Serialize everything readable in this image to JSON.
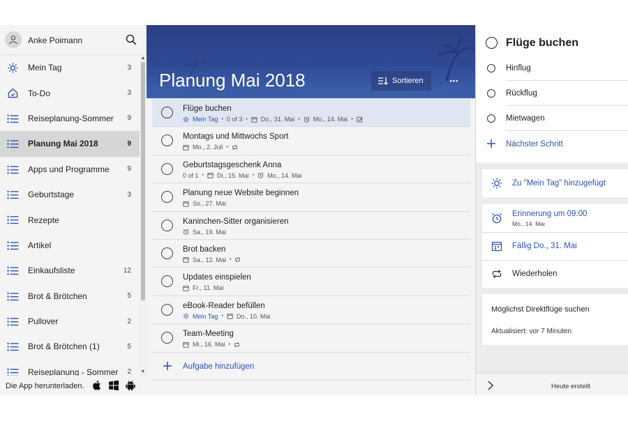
{
  "user": {
    "name": "Anke Poimann"
  },
  "sidebar": {
    "items": [
      {
        "label": "Mein Tag",
        "count": "3",
        "icon": "sun-icon"
      },
      {
        "label": "To-Do",
        "count": "3",
        "icon": "home-icon"
      },
      {
        "label": "Reiseplanung-Sommer",
        "count": "9",
        "icon": "list-icon"
      },
      {
        "label": "Planung Mai 2018",
        "count": "9",
        "icon": "list-icon",
        "active": true
      },
      {
        "label": "Apps und Programme",
        "count": "9",
        "icon": "list-icon"
      },
      {
        "label": "Geburtstage",
        "count": "3",
        "icon": "list-icon"
      },
      {
        "label": "Rezepte",
        "count": "",
        "icon": "list-icon"
      },
      {
        "label": "Artikel",
        "count": "",
        "icon": "list-icon"
      },
      {
        "label": "Einkaufsliste",
        "count": "12",
        "icon": "list-icon"
      },
      {
        "label": "Brot & Brötchen",
        "count": "5",
        "icon": "list-icon"
      },
      {
        "label": "Pullover",
        "count": "2",
        "icon": "list-icon"
      },
      {
        "label": "Brot & Brötchen (1)",
        "count": "5",
        "icon": "list-icon"
      },
      {
        "label": "Reiseplanung - Sommer",
        "count": "2",
        "icon": "list-icon"
      }
    ],
    "download_label": "Die App herunterladen."
  },
  "main": {
    "title": "Planung Mai 2018",
    "sort_label": "Sortieren",
    "more_label": "•••",
    "add_task_label": "Aufgabe hinzufügen",
    "tasks": [
      {
        "title": "Flüge buchen",
        "selected": true,
        "meta": [
          {
            "icon": "sun-icon",
            "text": "Mein Tag",
            "blue": true
          },
          {
            "text": "0 of 3"
          },
          {
            "icon": "calendar-icon",
            "text": "Do., 31. Mai"
          },
          {
            "icon": "alarm-icon",
            "text": "Mo., 14. Mai"
          },
          {
            "icon": "note-icon",
            "text": ""
          }
        ]
      },
      {
        "title": "Montags und Mittwochs Sport",
        "meta": [
          {
            "icon": "calendar-icon",
            "text": "Mo., 2. Juli"
          },
          {
            "icon": "repeat-icon",
            "text": ""
          }
        ]
      },
      {
        "title": "Geburtstagsgeschenk Anna",
        "meta": [
          {
            "text": "0 of 1"
          },
          {
            "icon": "calendar-icon",
            "text": "Di., 15. Mai"
          },
          {
            "icon": "alarm-icon",
            "text": "Mo., 14. Mai"
          }
        ]
      },
      {
        "title": "Planung neue Website beginnen",
        "meta": [
          {
            "icon": "calendar-icon",
            "text": "So., 27. Mai"
          }
        ]
      },
      {
        "title": "Kaninchen-Sitter organisieren",
        "meta": [
          {
            "icon": "alarm-icon",
            "text": "Sa., 19. Mai"
          }
        ]
      },
      {
        "title": "Brot backen",
        "meta": [
          {
            "icon": "calendar-icon",
            "text": "Sa., 12. Mai"
          },
          {
            "icon": "repeat-icon",
            "text": ""
          }
        ]
      },
      {
        "title": "Updates einspielen",
        "meta": [
          {
            "icon": "calendar-icon",
            "text": "Fr., 11. Mai"
          }
        ]
      },
      {
        "title": "eBook-Reader befüllen",
        "meta": [
          {
            "icon": "sun-icon",
            "text": "Mein Tag",
            "blue": true
          },
          {
            "icon": "calendar-icon",
            "text": "Do., 10. Mai"
          }
        ]
      },
      {
        "title": "Team-Meeting",
        "meta": [
          {
            "icon": "calendar-icon",
            "text": "Mi., 16. Mai"
          },
          {
            "icon": "repeat-icon",
            "text": ""
          }
        ]
      }
    ]
  },
  "detail": {
    "title": "Flüge buchen",
    "steps": [
      "Hinflug",
      "Rückflug",
      "Mietwagen"
    ],
    "next_step_label": "Nächster Schritt",
    "my_day_label": "Zu \"Mein Tag\" hinzugefügt",
    "reminder_label": "Erinnerung um 09:00",
    "reminder_date": "Mo., 14. Mai",
    "due_label": "Fällig Do., 31. Mai",
    "repeat_label": "Wiederholen",
    "note_text": "Möglichst Direktflüge suchen",
    "note_updated": "Aktualisiert: vor 7 Minuten",
    "footer_label": "Heute erstellt"
  },
  "colors": {
    "accent": "#2b53b5",
    "banner": "#2f4a95",
    "selected_row": "#dfe6f1",
    "sidebar_bg": "#f4f4f4",
    "active_item": "#d6d6d6"
  }
}
